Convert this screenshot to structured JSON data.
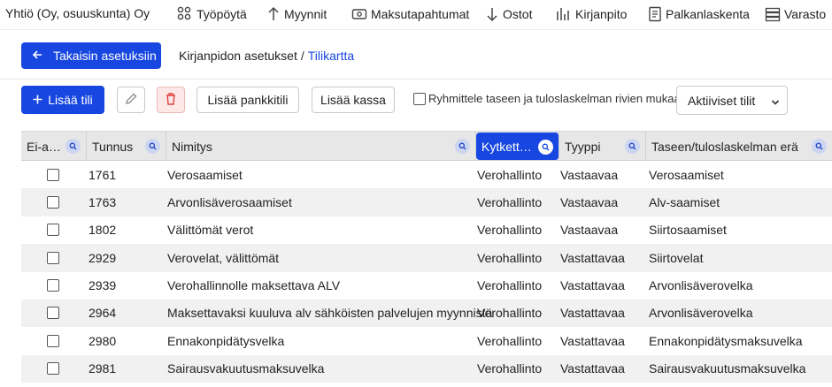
{
  "company": "Yhtiö (Oy, osuuskunta) Oy",
  "nav": [
    {
      "label": "Työpöytä",
      "icon": "dashboard-icon"
    },
    {
      "label": "Myynnit",
      "icon": "arrow-up-icon"
    },
    {
      "label": "Maksutapahtumat",
      "icon": "payment-card-icon"
    },
    {
      "label": "Ostot",
      "icon": "arrow-down-icon"
    },
    {
      "label": "Kirjanpito",
      "icon": "bar-chart-icon"
    },
    {
      "label": "Palkanlaskenta",
      "icon": "document-icon"
    },
    {
      "label": "Varasto",
      "icon": "warehouse-icon"
    }
  ],
  "back_button": "Takaisin asetuksiin",
  "breadcrumb": {
    "parent": "Kirjanpidon asetukset",
    "separator": "/",
    "current": "Tilikartta"
  },
  "toolbar": {
    "add_account": "Lisää tili",
    "add_bank_account": "Lisää pankkitili",
    "add_cash": "Lisää kassa",
    "group_checkbox_label": "Ryhmittele taseen ja tuloslaskelman rivien mukaan",
    "filter_select": "Aktiiviset tilit"
  },
  "table": {
    "headers": [
      "Ei-a…",
      "Tunnus",
      "Nimitys",
      "Kytkett…",
      "Tyyppi",
      "Taseen/tuloslaskelman erä"
    ],
    "active_header_index": 3,
    "rows": [
      {
        "code": "1761",
        "name": "Verosaamiset",
        "linked": "Verohallinto",
        "type": "Vastaavaa",
        "item": "Verosaamiset"
      },
      {
        "code": "1763",
        "name": "Arvonlisäverosaamiset",
        "linked": "Verohallinto",
        "type": "Vastaavaa",
        "item": "Alv-saamiset"
      },
      {
        "code": "1802",
        "name": "Välittömät verot",
        "linked": "Verohallinto",
        "type": "Vastaavaa",
        "item": "Siirtosaamiset"
      },
      {
        "code": "2929",
        "name": "Verovelat, välittömät",
        "linked": "Verohallinto",
        "type": "Vastattavaa",
        "item": "Siirtovelat"
      },
      {
        "code": "2939",
        "name": "Verohallinnolle maksettava ALV",
        "linked": "Verohallinto",
        "type": "Vastattavaa",
        "item": "Arvonlisäverovelka"
      },
      {
        "code": "2964",
        "name": "Maksettavaksi kuuluva alv sähköisten palvelujen myynnistä",
        "linked": "Verohallinto",
        "type": "Vastattavaa",
        "item": "Arvonlisäverovelka"
      },
      {
        "code": "2980",
        "name": "Ennakonpidätysvelka",
        "linked": "Verohallinto",
        "type": "Vastattavaa",
        "item": "Ennakonpidätysmaksuvelka"
      },
      {
        "code": "2981",
        "name": "Sairausvakuutusmaksuvelka",
        "linked": "Verohallinto",
        "type": "Vastattavaa",
        "item": "Sairausvakuutusmaksuvelka"
      }
    ]
  },
  "colors": {
    "primary": "#1746e0",
    "header_bg": "#e7e7e7",
    "alt_row": "#f1f1f1",
    "delete_bg": "#fde7e7",
    "delete_icon": "#e04040"
  }
}
